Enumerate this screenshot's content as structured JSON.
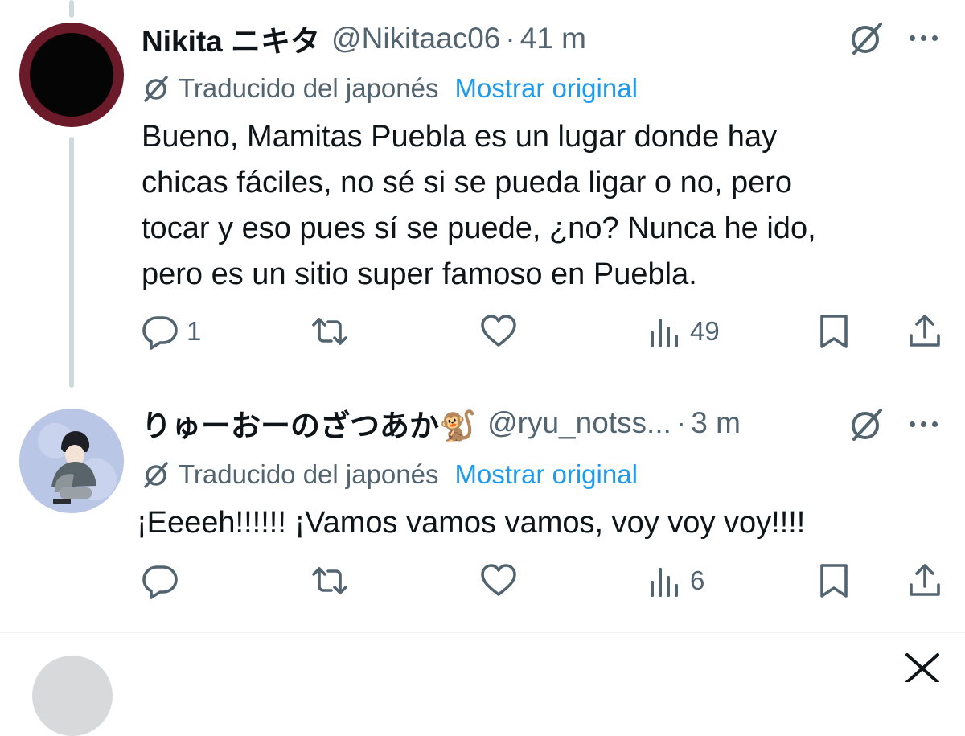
{
  "tweets": [
    {
      "name": "Nikita ニキタ",
      "handle": "@Nikitaac06",
      "separator": "·",
      "time": "41 m",
      "translation_label": "Traducido del japonés",
      "show_original": "Mostrar original",
      "text_lines": [
        "Bueno, Mamitas Puebla es un lugar donde hay",
        "chicas fáciles, no sé si se pueda ligar o no, pero",
        "tocar y eso pues sí se puede, ¿no? Nunca he ido,",
        "pero es un sitio super famoso en Puebla."
      ],
      "reply_count": "1",
      "views_count": "49"
    },
    {
      "name": "りゅーおーのざつあか🐒",
      "handle": "@ryu_notss...",
      "separator": "·",
      "time": "3 m",
      "translation_label": "Traducido del japonés",
      "show_original": "Mostrar original",
      "text_lines": [
        "¡Eeeeh!!!!!! ¡Vamos vamos vamos, voy voy voy!!!!"
      ],
      "reply_count": "",
      "views_count": "6"
    }
  ],
  "icons": {
    "reply": "reply-icon",
    "retweet": "retweet-icon",
    "like": "like-icon",
    "views": "views-icon",
    "bookmark": "bookmark-icon",
    "share": "share-icon",
    "grok": "grok-icon",
    "more": "more-icon",
    "translate": "translate-icon"
  },
  "colors": {
    "text": "#0f1419",
    "secondary": "#536471",
    "link": "#1d9bf0",
    "thread_line": "#cfd9de",
    "avatar1_ring": "#6b1a2a",
    "avatar2_bg": "#b9c6e6"
  }
}
